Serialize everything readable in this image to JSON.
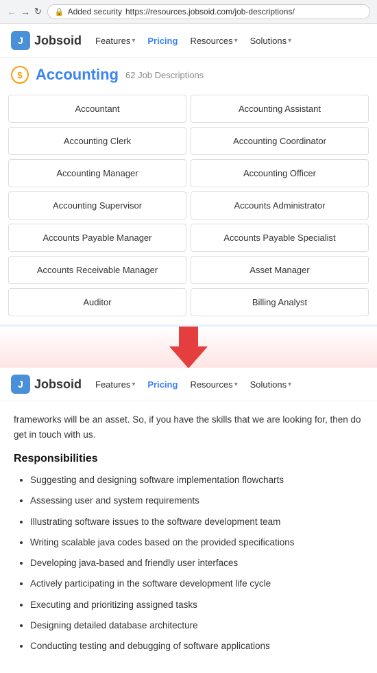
{
  "browser": {
    "back_arrow": "←",
    "forward_arrow": "→",
    "refresh": "↻",
    "security_label": "Added security",
    "url": "https://resources.jobsoid.com/job-descriptions/"
  },
  "top_navbar": {
    "logo_text": "Jobsoid",
    "logo_icon": "J",
    "nav_items": [
      {
        "label": "Features",
        "has_dropdown": true
      },
      {
        "label": "Pricing",
        "has_dropdown": false
      },
      {
        "label": "Resources",
        "has_dropdown": true
      },
      {
        "label": "Solutions",
        "has_dropdown": true
      }
    ]
  },
  "category": {
    "icon": "$",
    "title": "Accounting",
    "count_label": "62 Job Descriptions"
  },
  "job_cards": [
    {
      "label": "Accountant"
    },
    {
      "label": "Accounting Assistant"
    },
    {
      "label": "Accounting Clerk"
    },
    {
      "label": "Accounting Coordinator"
    },
    {
      "label": "Accounting Manager"
    },
    {
      "label": "Accounting Officer"
    },
    {
      "label": "Accounting Supervisor"
    },
    {
      "label": "Accounts Administrator"
    },
    {
      "label": "Accounts Payable Manager"
    },
    {
      "label": "Accounts Payable Specialist"
    },
    {
      "label": "Accounts Receivable Manager"
    },
    {
      "label": "Asset Manager"
    },
    {
      "label": "Auditor"
    },
    {
      "label": "Billing Analyst"
    }
  ],
  "bottom_navbar": {
    "logo_text": "Jobsoid",
    "logo_icon": "J",
    "nav_items": [
      {
        "label": "Features",
        "has_dropdown": true
      },
      {
        "label": "Pricing",
        "has_dropdown": false
      },
      {
        "label": "Resources",
        "has_dropdown": true
      },
      {
        "label": "Solutions",
        "has_dropdown": true
      }
    ]
  },
  "content": {
    "intro": "frameworks will be an asset. So, if you have the skills that we are looking for, then do get in touch with us.",
    "responsibilities_title": "Responsibilities",
    "responsibilities": [
      "Suggesting and designing software implementation flowcharts",
      "Assessing user and system requirements",
      "Illustrating software issues to the software development team",
      "Writing scalable java codes based on the provided specifications",
      "Developing java-based and friendly user interfaces",
      "Actively participating in the software development life cycle",
      "Executing and prioritizing assigned tasks",
      "Designing detailed database architecture",
      "Conducting testing and debugging of software applications"
    ]
  }
}
